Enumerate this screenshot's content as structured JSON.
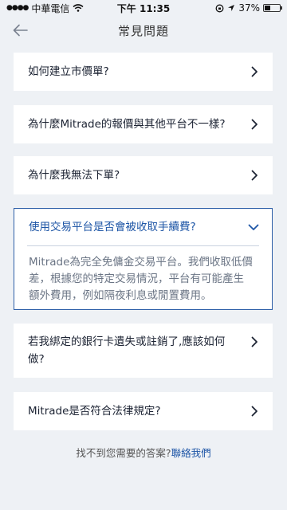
{
  "status_bar": {
    "carrier": "中華電信",
    "time": "下午 11:35",
    "battery": "37%",
    "battery_level": 0.37
  },
  "header": {
    "title": "常見問題",
    "back_icon": "arrow-left-icon"
  },
  "faq": {
    "q1": "如何建立市價單?",
    "q2": "為什麼Mitrade的報價與其他平台不一樣?",
    "q3": "為什麼我無法下單?",
    "q4": "使用交易平台是否會被收取手續費?",
    "a4_line1": "Mitrade為完全免傭金交易平台。我們收取低價",
    "a4_line2": "差，根據您的特定交易情況，平台有可能產生",
    "a4_line3": "額外費用，例如隔夜利息或閒置費用。",
    "q5_line1": "若我綁定的銀行卡遺失或註銷了,應該如何",
    "q5_line2": "做?",
    "q6": "Mitrade是否符合法律規定?"
  },
  "footer": {
    "text": "找不到您需要的答案?",
    "link": "聯絡我們"
  },
  "colors": {
    "accent": "#1d55a6",
    "background": "#eef1f5",
    "card": "#ffffff"
  }
}
